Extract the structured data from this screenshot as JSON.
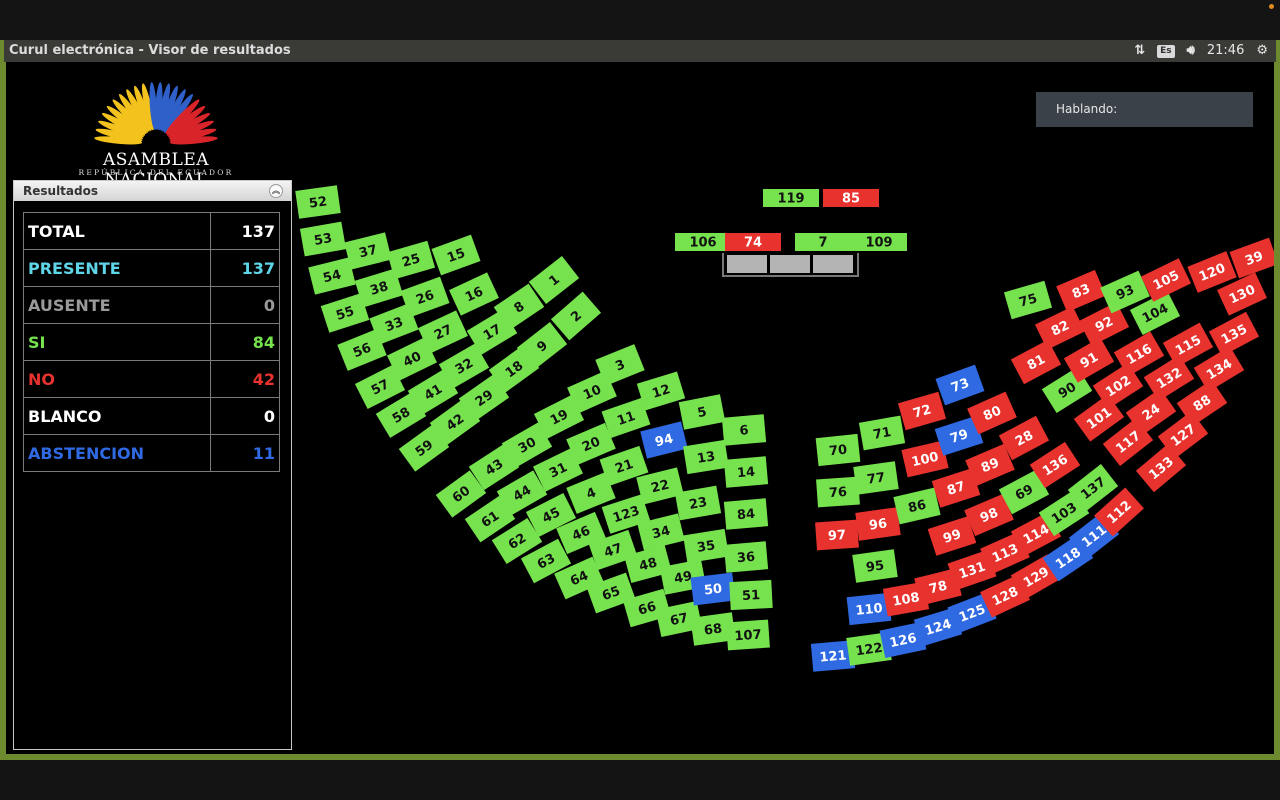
{
  "window": {
    "title": "Curul electrónica - Visor de resultados"
  },
  "tray": {
    "lang": "Es",
    "time": "21:46",
    "icons": [
      "network-icon",
      "keyboard-layout-icon",
      "volume-icon",
      "settings-gear-icon"
    ]
  },
  "logo": {
    "name": "ASAMBLEA NACIONAL",
    "subtitle": "REPÚBLICA DEL ECUADOR"
  },
  "results_panel": {
    "title": "Resultados",
    "rows": [
      {
        "label": "TOTAL",
        "value": "137",
        "color": "#ffffff"
      },
      {
        "label": "PRESENTE",
        "value": "137",
        "color": "#5fd6e8"
      },
      {
        "label": "AUSENTE",
        "value": "0",
        "color": "#9a9a9a"
      },
      {
        "label": "SI",
        "value": "84",
        "color": "#76e24e"
      },
      {
        "label": "NO",
        "value": "42",
        "color": "#e8322e"
      },
      {
        "label": "BLANCO",
        "value": "0",
        "color": "#ffffff"
      },
      {
        "label": "ABSTENCION",
        "value": "11",
        "color": "#2f6ae3"
      }
    ]
  },
  "speaking": {
    "label": "Hablando:"
  },
  "colors": {
    "si": "#76e24e",
    "no": "#e8322e",
    "abstencion": "#2f6ae3"
  },
  "seats": {
    "presidium": [
      {
        "n": "119",
        "v": "si"
      },
      {
        "n": "85",
        "v": "no"
      },
      {
        "n": "106",
        "v": "si"
      },
      {
        "n": "74",
        "v": "no"
      },
      {
        "n": "7",
        "v": "si"
      },
      {
        "n": "109",
        "v": "si"
      }
    ],
    "left": [
      [
        "52",
        "53",
        "54",
        "55",
        "56",
        "57",
        "58",
        "59"
      ],
      [
        "37",
        "38",
        "33",
        "40",
        "41",
        "42"
      ],
      [
        "25",
        "26",
        "27",
        "32",
        "29"
      ],
      [
        "15",
        "16",
        "17",
        "18"
      ],
      [
        "8",
        "9"
      ],
      [
        "1",
        "2"
      ],
      [
        "60",
        "61",
        "62",
        "63",
        "64",
        "65",
        "66",
        "67",
        "68",
        "107"
      ],
      [
        "43",
        "44",
        "45",
        "46",
        "47",
        "48",
        "49",
        "50",
        "51"
      ],
      [
        "30",
        "31",
        "4",
        "123",
        "34",
        "35",
        "36"
      ],
      [
        "19",
        "20",
        "21",
        "22",
        "23",
        "84"
      ],
      [
        "10",
        "11",
        "94",
        "13",
        "14"
      ],
      [
        "3",
        "12",
        "5",
        "6"
      ]
    ],
    "left_abst": [
      "94",
      "50"
    ],
    "right": [
      {
        "n": "70",
        "v": "si"
      },
      {
        "n": "71",
        "v": "si"
      },
      {
        "n": "72",
        "v": "no"
      },
      {
        "n": "73",
        "v": "abstencion"
      },
      {
        "n": "76",
        "v": "si"
      },
      {
        "n": "77",
        "v": "si"
      },
      {
        "n": "100",
        "v": "no"
      },
      {
        "n": "79",
        "v": "abstencion"
      },
      {
        "n": "80",
        "v": "no"
      },
      {
        "n": "97",
        "v": "no"
      },
      {
        "n": "96",
        "v": "no"
      },
      {
        "n": "86",
        "v": "si"
      },
      {
        "n": "87",
        "v": "no"
      },
      {
        "n": "89",
        "v": "no"
      },
      {
        "n": "28",
        "v": "no"
      },
      {
        "n": "95",
        "v": "si"
      },
      {
        "n": "99",
        "v": "no"
      },
      {
        "n": "98",
        "v": "no"
      },
      {
        "n": "69",
        "v": "si"
      },
      {
        "n": "136",
        "v": "no"
      },
      {
        "n": "110",
        "v": "abstencion"
      },
      {
        "n": "108",
        "v": "no"
      },
      {
        "n": "78",
        "v": "no"
      },
      {
        "n": "131",
        "v": "no"
      },
      {
        "n": "113",
        "v": "no"
      },
      {
        "n": "114",
        "v": "no"
      },
      {
        "n": "103",
        "v": "si"
      },
      {
        "n": "137",
        "v": "si"
      },
      {
        "n": "121",
        "v": "abstencion"
      },
      {
        "n": "122",
        "v": "si"
      },
      {
        "n": "126",
        "v": "abstencion"
      },
      {
        "n": "124",
        "v": "abstencion"
      },
      {
        "n": "125",
        "v": "abstencion"
      },
      {
        "n": "128",
        "v": "no"
      },
      {
        "n": "129",
        "v": "no"
      },
      {
        "n": "118",
        "v": "abstencion"
      },
      {
        "n": "111",
        "v": "abstencion"
      },
      {
        "n": "112",
        "v": "no"
      },
      {
        "n": "75",
        "v": "si"
      },
      {
        "n": "81",
        "v": "no"
      },
      {
        "n": "82",
        "v": "no"
      },
      {
        "n": "83",
        "v": "no"
      },
      {
        "n": "90",
        "v": "si"
      },
      {
        "n": "91",
        "v": "no"
      },
      {
        "n": "92",
        "v": "no"
      },
      {
        "n": "93",
        "v": "si"
      },
      {
        "n": "101",
        "v": "no"
      },
      {
        "n": "102",
        "v": "no"
      },
      {
        "n": "116",
        "v": "no"
      },
      {
        "n": "104",
        "v": "si"
      },
      {
        "n": "117",
        "v": "no"
      },
      {
        "n": "24",
        "v": "no"
      },
      {
        "n": "132",
        "v": "no"
      },
      {
        "n": "115",
        "v": "no"
      },
      {
        "n": "105",
        "v": "no"
      },
      {
        "n": "133",
        "v": "no"
      },
      {
        "n": "127",
        "v": "no"
      },
      {
        "n": "88",
        "v": "no"
      },
      {
        "n": "134",
        "v": "no"
      },
      {
        "n": "135",
        "v": "no"
      },
      {
        "n": "130",
        "v": "no"
      },
      {
        "n": "120",
        "v": "no"
      },
      {
        "n": "39",
        "v": "no"
      }
    ]
  }
}
